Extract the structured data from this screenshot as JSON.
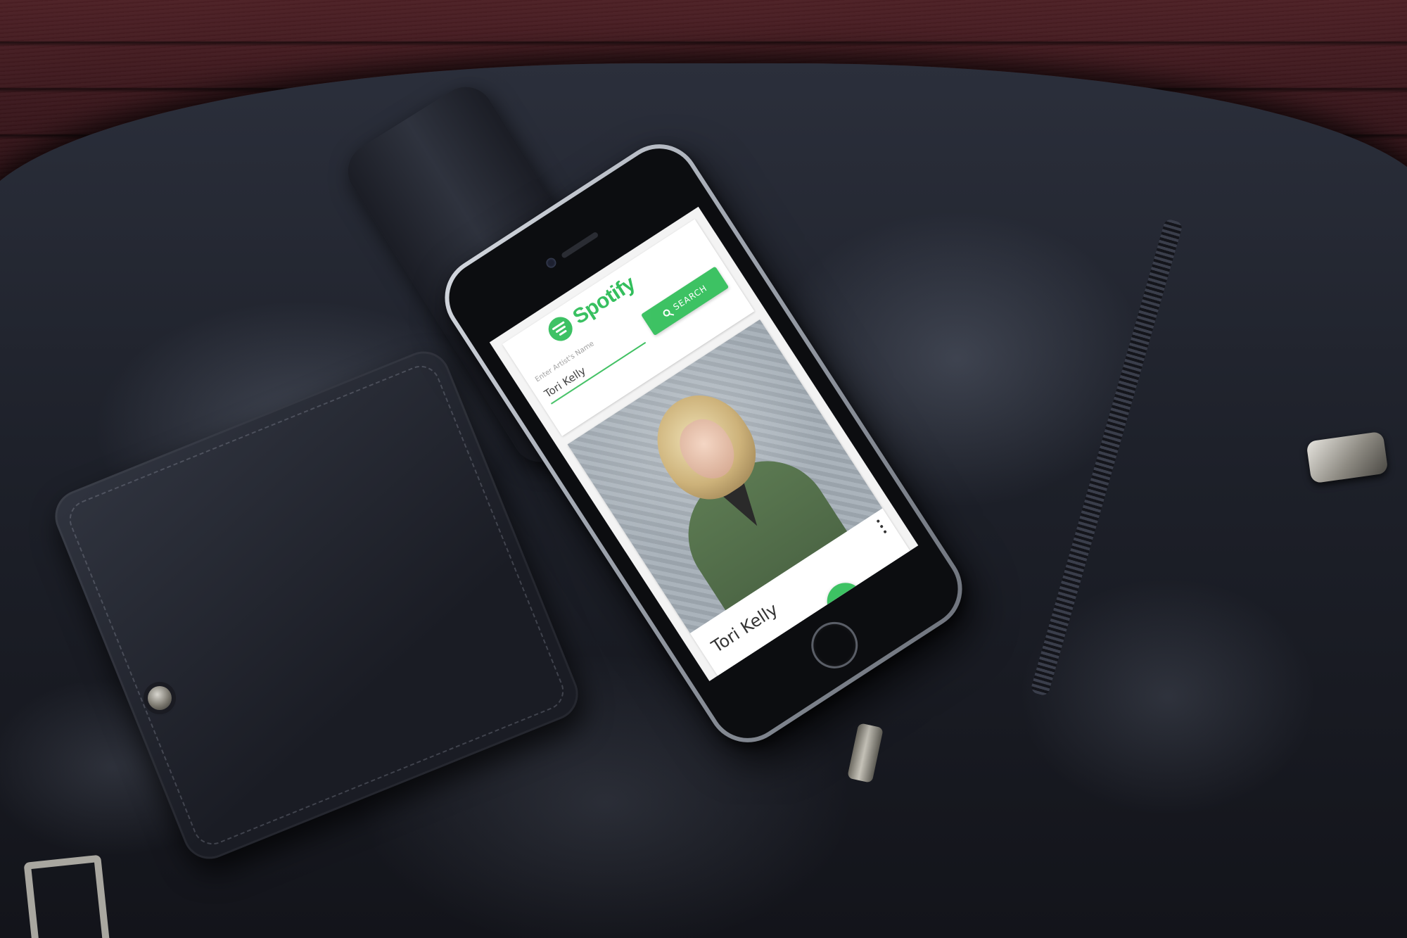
{
  "app": {
    "logo_text": "Spotify",
    "brand_color": "#3dc263"
  },
  "search": {
    "label": "Enter Artist's Name",
    "value": "Tori Kelly",
    "button_label": "SEARCH",
    "button_icon": "search-icon"
  },
  "result": {
    "artist_name": "Tori Kelly",
    "menu_icon": "more-vert-icon"
  }
}
